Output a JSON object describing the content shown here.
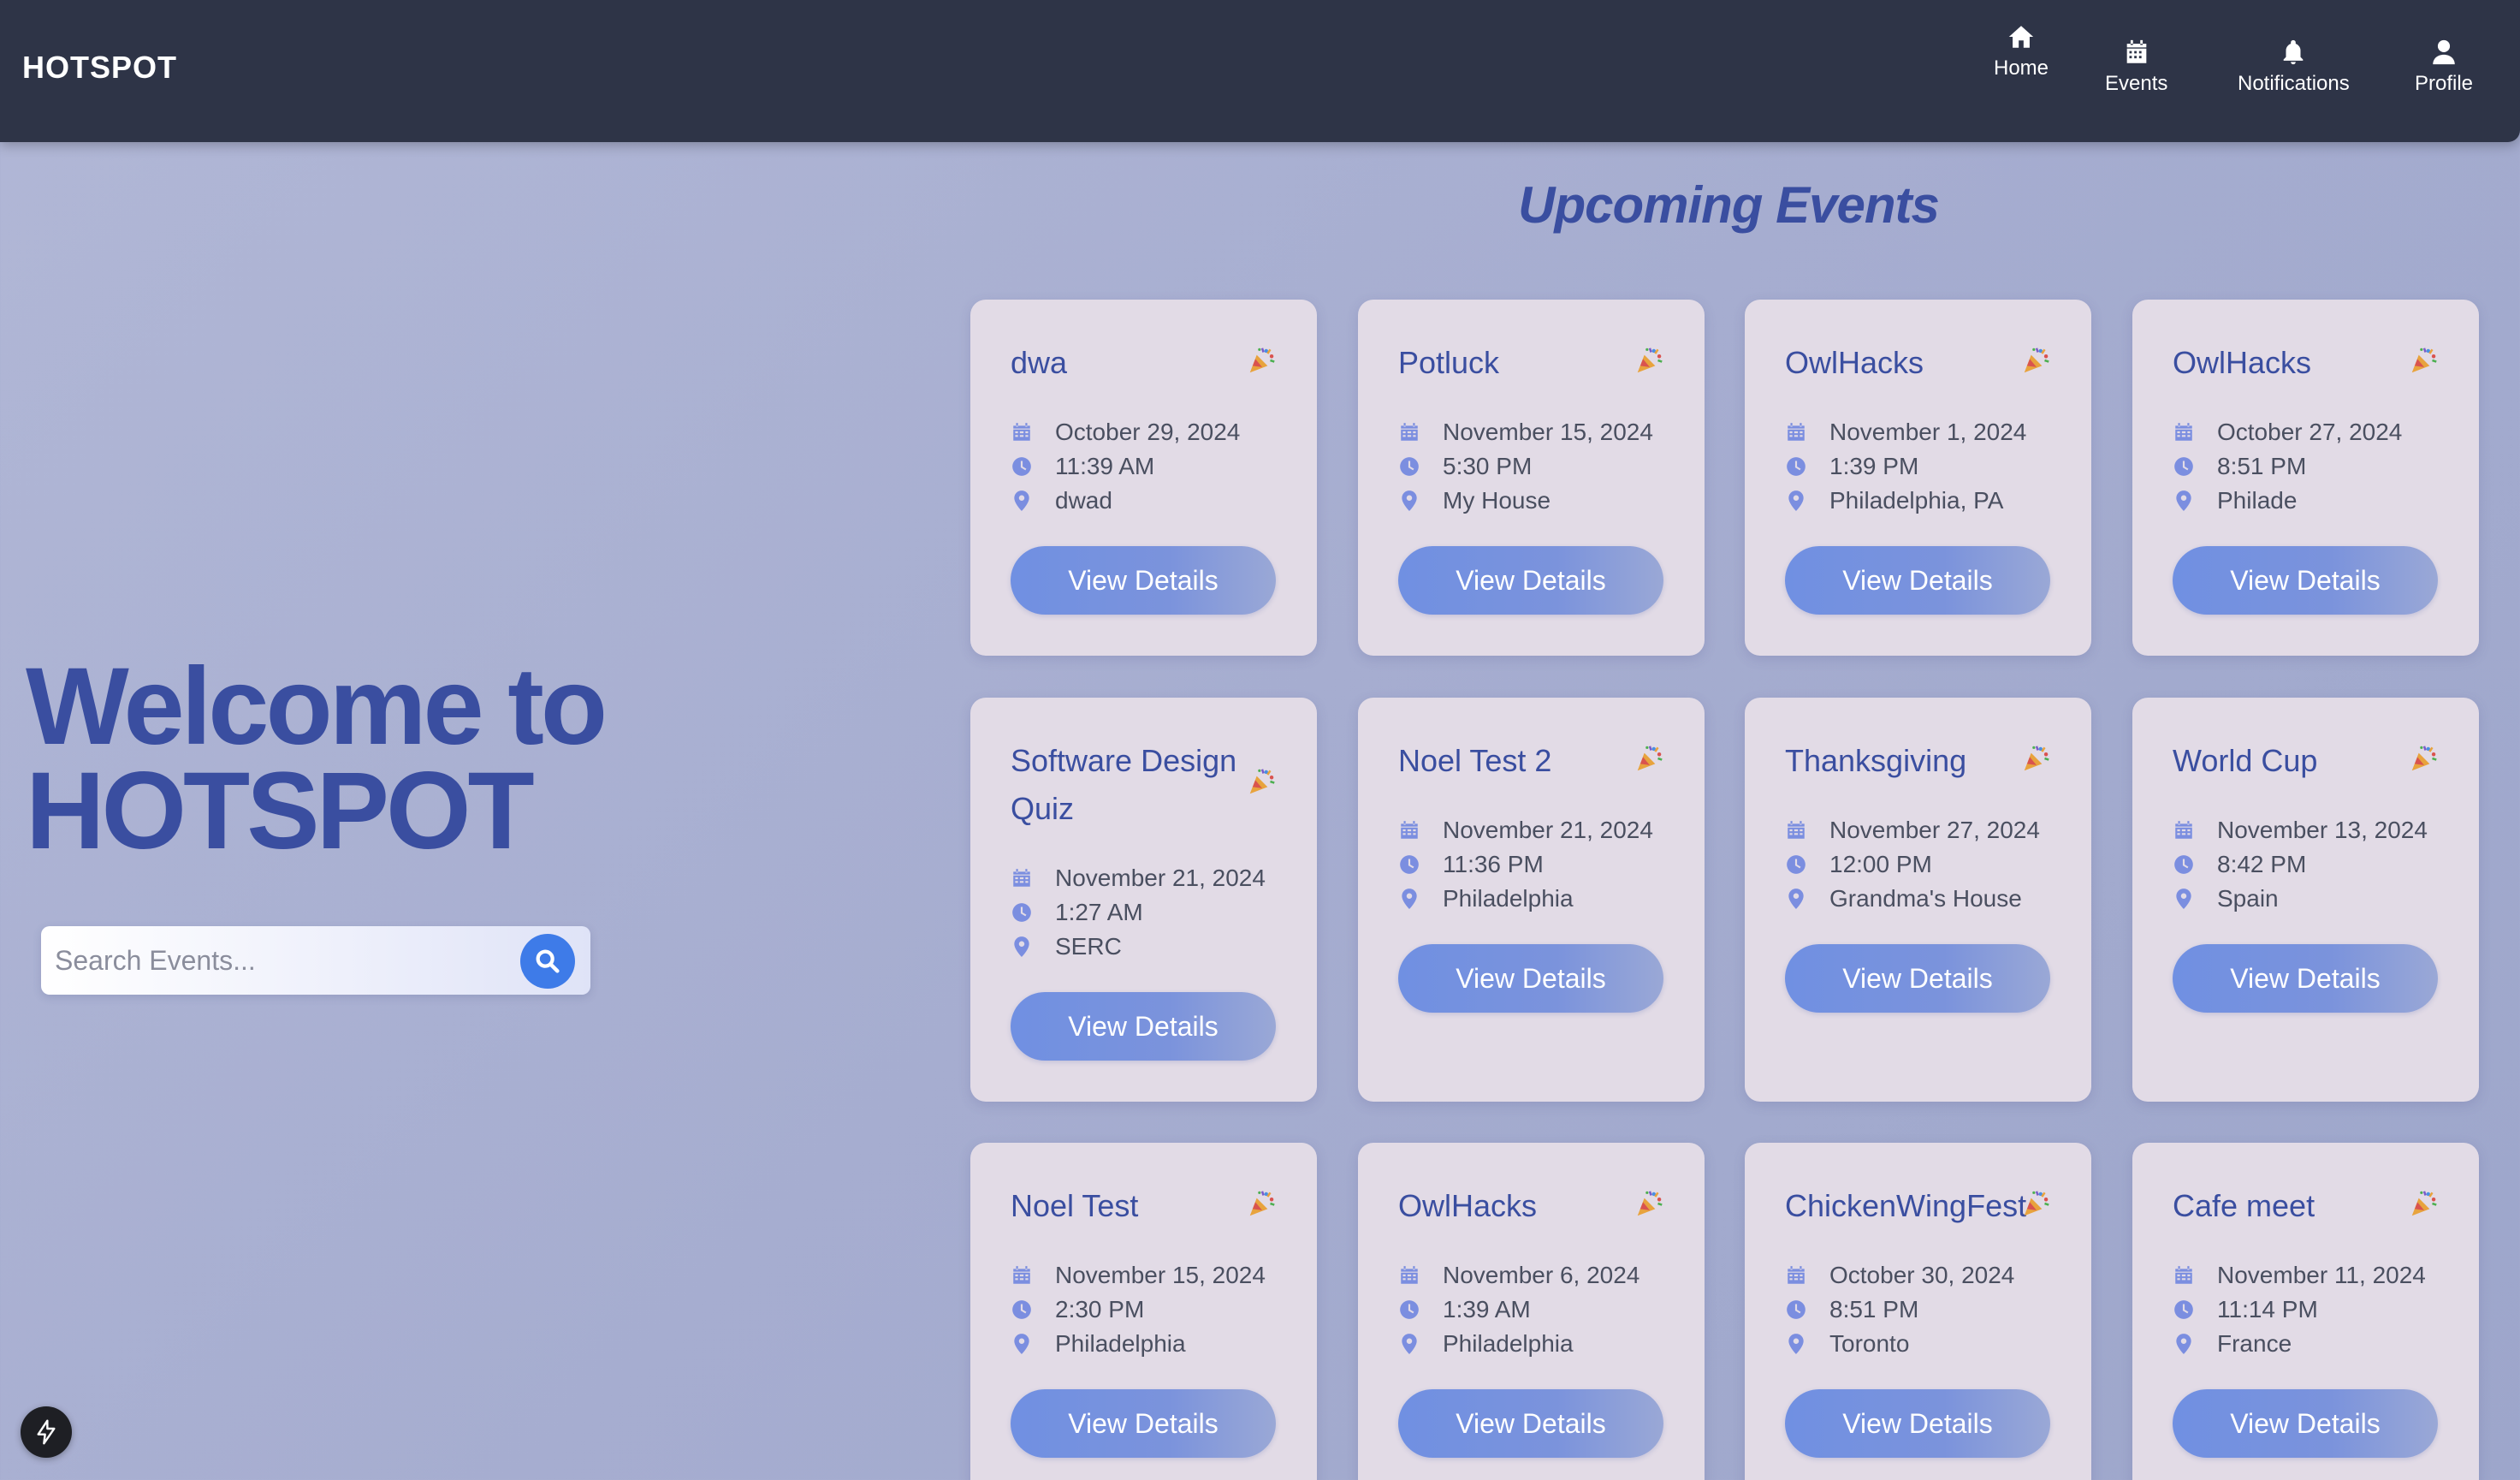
{
  "nav": {
    "brand": "HOTSPOT",
    "items": [
      {
        "label": "Home",
        "icon": "home-icon"
      },
      {
        "label": "Events",
        "icon": "calendar-icon"
      },
      {
        "label": "Notifications",
        "icon": "bell-icon"
      },
      {
        "label": "Profile",
        "icon": "user-icon"
      }
    ]
  },
  "hero": {
    "line1": "Welcome to",
    "line2": "HOTSPOT",
    "search_placeholder": "Search Events..."
  },
  "section": {
    "title": "Upcoming Events"
  },
  "card_button_label": "View Details",
  "events": [
    {
      "title": "dwa",
      "date": "October 29, 2024",
      "time": "11:39 AM",
      "location": "dwad"
    },
    {
      "title": "Potluck",
      "date": "November 15, 2024",
      "time": "5:30 PM",
      "location": "My House"
    },
    {
      "title": "OwlHacks",
      "date": "November 1, 2024",
      "time": "1:39 PM",
      "location": "Philadelphia, PA"
    },
    {
      "title": "OwlHacks",
      "date": "October 27, 2024",
      "time": "8:51 PM",
      "location": "Philade"
    },
    {
      "title": "Software Design Quiz",
      "date": "November 21, 2024",
      "time": "1:27 AM",
      "location": "SERC"
    },
    {
      "title": "Noel Test 2",
      "date": "November 21, 2024",
      "time": "11:36 PM",
      "location": "Philadelphia"
    },
    {
      "title": "Thanksgiving",
      "date": "November 27, 2024",
      "time": "12:00 PM",
      "location": "Grandma's House"
    },
    {
      "title": "World Cup",
      "date": "November 13, 2024",
      "time": "8:42 PM",
      "location": "Spain"
    },
    {
      "title": "Noel Test",
      "date": "November 15, 2024",
      "time": "2:30 PM",
      "location": "Philadelphia"
    },
    {
      "title": "OwlHacks",
      "date": "November 6, 2024",
      "time": "1:39 AM",
      "location": "Philadelphia"
    },
    {
      "title": "ChickenWingFest",
      "date": "October 30, 2024",
      "time": "8:51 PM",
      "location": "Toronto"
    },
    {
      "title": "Cafe meet",
      "date": "November 11, 2024",
      "time": "11:14 PM",
      "location": "France"
    }
  ],
  "colors": {
    "navbar": "#2e3447",
    "accent": "#3a4ea0",
    "card": "#e2dbe6",
    "button": "#7090e2",
    "search_button": "#3e7be8"
  }
}
